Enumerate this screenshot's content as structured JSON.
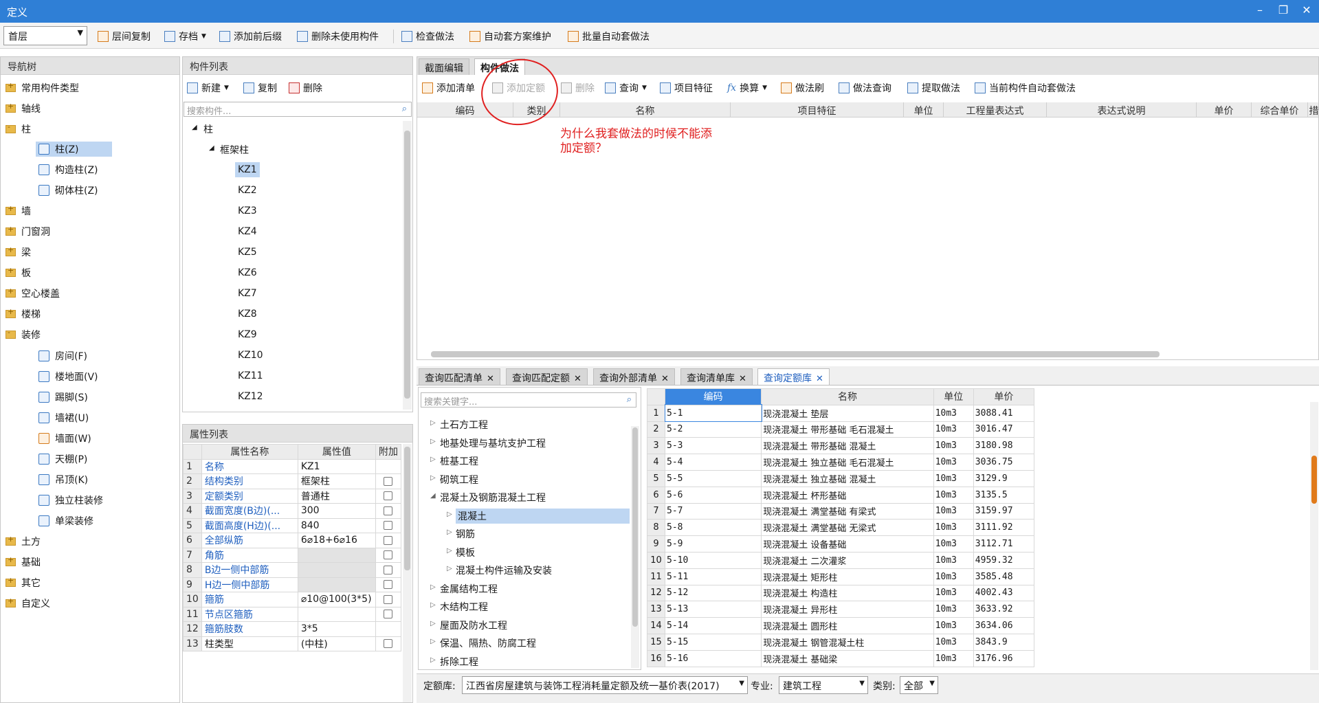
{
  "window": {
    "title": "定义",
    "minimize": "–",
    "restore": "❐",
    "close": "✕"
  },
  "toolbar": {
    "floor_value": "首层",
    "buttons": [
      "层间复制",
      "存档",
      "添加前后缀",
      "删除未使用构件",
      "检查做法",
      "自动套方案维护",
      "批量自动套做法"
    ]
  },
  "nav": {
    "title": "导航树",
    "items": [
      {
        "label": "常用构件类型",
        "level": 0
      },
      {
        "label": "轴线",
        "level": 0
      },
      {
        "label": "柱",
        "level": 0,
        "open": true
      },
      {
        "label": "柱(Z)",
        "level": 1,
        "selected": true
      },
      {
        "label": "构造柱(Z)",
        "level": 1
      },
      {
        "label": "砌体柱(Z)",
        "level": 1
      },
      {
        "label": "墙",
        "level": 0
      },
      {
        "label": "门窗洞",
        "level": 0
      },
      {
        "label": "梁",
        "level": 0
      },
      {
        "label": "板",
        "level": 0
      },
      {
        "label": "空心楼盖",
        "level": 0
      },
      {
        "label": "楼梯",
        "level": 0
      },
      {
        "label": "装修",
        "level": 0,
        "open": true
      },
      {
        "label": "房间(F)",
        "level": 1
      },
      {
        "label": "楼地面(V)",
        "level": 1
      },
      {
        "label": "踢脚(S)",
        "level": 1
      },
      {
        "label": "墙裙(U)",
        "level": 1
      },
      {
        "label": "墙面(W)",
        "level": 1
      },
      {
        "label": "天棚(P)",
        "level": 1
      },
      {
        "label": "吊顶(K)",
        "level": 1
      },
      {
        "label": "独立柱装修",
        "level": 1
      },
      {
        "label": "单梁装修",
        "level": 1
      },
      {
        "label": "土方",
        "level": 0
      },
      {
        "label": "基础",
        "level": 0
      },
      {
        "label": "其它",
        "level": 0
      },
      {
        "label": "自定义",
        "level": 0
      }
    ]
  },
  "components": {
    "title": "构件列表",
    "new_label": "新建",
    "copy_label": "复制",
    "delete_label": "删除",
    "search_placeholder": "搜索构件...",
    "root": "柱",
    "group": "框架柱",
    "items": [
      "KZ1",
      "KZ2",
      "KZ3",
      "KZ4",
      "KZ5",
      "KZ6",
      "KZ7",
      "KZ8",
      "KZ9",
      "KZ10",
      "KZ11",
      "KZ12"
    ]
  },
  "properties": {
    "title": "属性列表",
    "headers": [
      "属性名称",
      "属性值",
      "附加"
    ],
    "rows": [
      {
        "n": "1",
        "name": "名称",
        "value": "KZ1",
        "check": false
      },
      {
        "n": "2",
        "name": "结构类别",
        "value": "框架柱",
        "check": true
      },
      {
        "n": "3",
        "name": "定额类别",
        "value": "普通柱",
        "check": true
      },
      {
        "n": "4",
        "name": "截面宽度(B边)(...",
        "value": "300",
        "check": true
      },
      {
        "n": "5",
        "name": "截面高度(H边)(...",
        "value": "840",
        "check": true
      },
      {
        "n": "6",
        "name": "全部纵筋",
        "value": "6⌀18+6⌀16",
        "check": true
      },
      {
        "n": "7",
        "name": "角筋",
        "value": "",
        "check": true,
        "gray": true
      },
      {
        "n": "8",
        "name": "B边一侧中部筋",
        "value": "",
        "check": true,
        "gray": true
      },
      {
        "n": "9",
        "name": "H边一侧中部筋",
        "value": "",
        "check": true,
        "gray": true
      },
      {
        "n": "10",
        "name": "箍筋",
        "value": "⌀10@100(3*5)",
        "check": true
      },
      {
        "n": "11",
        "name": "节点区箍筋",
        "value": "",
        "check": true
      },
      {
        "n": "12",
        "name": "箍筋肢数",
        "value": "3*5",
        "check": false
      },
      {
        "n": "13",
        "name": "柱类型",
        "value": "(中柱)",
        "check": true,
        "black": true
      }
    ]
  },
  "method_tabs": [
    "截面编辑",
    "构件做法"
  ],
  "method_toolbar": [
    "添加清单",
    "添加定额",
    "删除",
    "查询",
    "项目特征",
    "换算",
    "做法刷",
    "做法查询",
    "提取做法",
    "当前构件自动套做法"
  ],
  "method_grid_headers": [
    "编码",
    "类别",
    "名称",
    "项目特征",
    "单位",
    "工程量表达式",
    "表达式说明",
    "单价",
    "综合单价",
    "措施项目"
  ],
  "annotation": "为什么我套做法的时候不能添加定额？",
  "query_tabs": [
    "查询匹配清单",
    "查询匹配定额",
    "查询外部清单",
    "查询清单库",
    "查询定额库"
  ],
  "query": {
    "search_placeholder": "搜索关键字...",
    "tree": [
      {
        "label": "土石方工程",
        "level": 0
      },
      {
        "label": "地基处理与基坑支护工程",
        "level": 0
      },
      {
        "label": "桩基工程",
        "level": 0
      },
      {
        "label": "砌筑工程",
        "level": 0
      },
      {
        "label": "混凝土及钢筋混凝土工程",
        "level": 0,
        "open": true
      },
      {
        "label": "混凝土",
        "level": 1,
        "selected": true
      },
      {
        "label": "钢筋",
        "level": 1
      },
      {
        "label": "模板",
        "level": 1
      },
      {
        "label": "混凝土构件运输及安装",
        "level": 1
      },
      {
        "label": "金属结构工程",
        "level": 0
      },
      {
        "label": "木结构工程",
        "level": 0
      },
      {
        "label": "屋面及防水工程",
        "level": 0
      },
      {
        "label": "保温、隔热、防腐工程",
        "level": 0
      },
      {
        "label": "拆除工程",
        "level": 0
      }
    ],
    "headers": [
      "编码",
      "名称",
      "单位",
      "单价"
    ],
    "rows": [
      [
        "1",
        "5-1",
        "现浇混凝土 垫层",
        "10m3",
        "3088.41"
      ],
      [
        "2",
        "5-2",
        "现浇混凝土 带形基础 毛石混凝土",
        "10m3",
        "3016.47"
      ],
      [
        "3",
        "5-3",
        "现浇混凝土 带形基础 混凝土",
        "10m3",
        "3180.98"
      ],
      [
        "4",
        "5-4",
        "现浇混凝土 独立基础 毛石混凝土",
        "10m3",
        "3036.75"
      ],
      [
        "5",
        "5-5",
        "现浇混凝土 独立基础 混凝土",
        "10m3",
        "3129.9"
      ],
      [
        "6",
        "5-6",
        "现浇混凝土 杯形基础",
        "10m3",
        "3135.5"
      ],
      [
        "7",
        "5-7",
        "现浇混凝土 满堂基础 有梁式",
        "10m3",
        "3159.97"
      ],
      [
        "8",
        "5-8",
        "现浇混凝土 满堂基础 无梁式",
        "10m3",
        "3111.92"
      ],
      [
        "9",
        "5-9",
        "现浇混凝土 设备基础",
        "10m3",
        "3112.71"
      ],
      [
        "10",
        "5-10",
        "现浇混凝土 二次灌浆",
        "10m3",
        "4959.32"
      ],
      [
        "11",
        "5-11",
        "现浇混凝土 矩形柱",
        "10m3",
        "3585.48"
      ],
      [
        "12",
        "5-12",
        "现浇混凝土 构造柱",
        "10m3",
        "4002.43"
      ],
      [
        "13",
        "5-13",
        "现浇混凝土 异形柱",
        "10m3",
        "3633.92"
      ],
      [
        "14",
        "5-14",
        "现浇混凝土 圆形柱",
        "10m3",
        "3634.06"
      ],
      [
        "15",
        "5-15",
        "现浇混凝土 钢管混凝土柱",
        "10m3",
        "3843.9"
      ],
      [
        "16",
        "5-16",
        "现浇混凝土 基础梁",
        "10m3",
        "3176.96"
      ]
    ],
    "filter": {
      "quota_label": "定额库:",
      "quota_value": "江西省房屋建筑与装饰工程消耗量定额及统一基价表(2017)",
      "major_label": "专业:",
      "major_value": "建筑工程",
      "category_label": "类别:",
      "category_value": "全部"
    }
  },
  "colors": {
    "titlebar": "#2f7fd6",
    "selection": "#bed6f2",
    "header_highlight": "#3a86e0",
    "annotation": "#e02020",
    "link_blue": "#1f5fbf"
  }
}
